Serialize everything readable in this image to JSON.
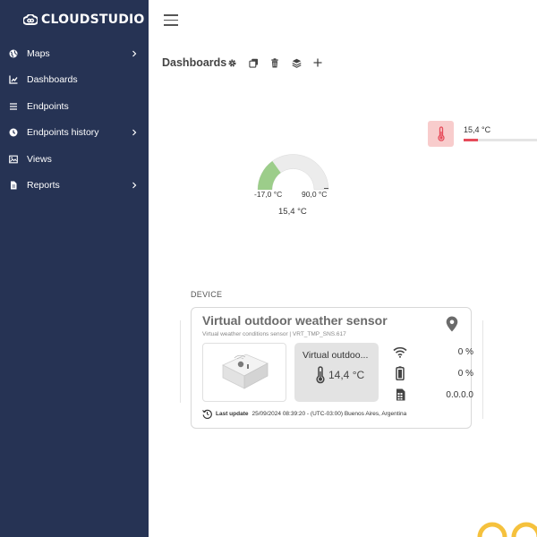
{
  "app": {
    "brand": "CLOUDSTUDIO"
  },
  "sidebar": {
    "items": [
      {
        "label": "Maps",
        "icon": "globe-icon",
        "has_submenu": true
      },
      {
        "label": "Dashboards",
        "icon": "chart-icon",
        "has_submenu": false
      },
      {
        "label": "Endpoints",
        "icon": "list-icon",
        "has_submenu": false
      },
      {
        "label": "Endpoints history",
        "icon": "clock-icon",
        "has_submenu": true
      },
      {
        "label": "Views",
        "icon": "image-icon",
        "has_submenu": false
      },
      {
        "label": "Reports",
        "icon": "file-icon",
        "has_submenu": true
      }
    ]
  },
  "header": {
    "title": "Dashboards",
    "toolbar": [
      "gear-icon",
      "copy-icon",
      "trash-icon",
      "layers-icon",
      "plus-icon"
    ]
  },
  "temp_widget": {
    "value": "15,4 °C",
    "level": 0.2
  },
  "gauge": {
    "min": "-17,0 °C",
    "max": "90,0 °C",
    "value": "15,4 °C",
    "fraction": 0.3
  },
  "device": {
    "heading": "DEVICE",
    "title": "Virtual outdoor weather sensor",
    "subtitle": "Virtual weather conditions sensor | VRT_TMP_SNS.617",
    "box_name": "Virtual outdoo...",
    "box_value": "14,4 °C",
    "stats": [
      {
        "icon": "wifi-icon",
        "value": "0 %"
      },
      {
        "icon": "battery-icon",
        "value": "0 %"
      },
      {
        "icon": "sim-card-icon",
        "value": "0.0.0.0"
      }
    ],
    "last_update_label": "Last update",
    "last_update_value": "25/09/2024 08:39:20 - (UTC-03:00) Buenos Aires, Argentina"
  },
  "colors": {
    "sidebar": "#263354",
    "gauge_fill": "#9ccd8a",
    "temp_bar": "#e64b5a",
    "temp_icon_bg": "#f8cccc",
    "accent_yellow": "#f5c13d"
  }
}
